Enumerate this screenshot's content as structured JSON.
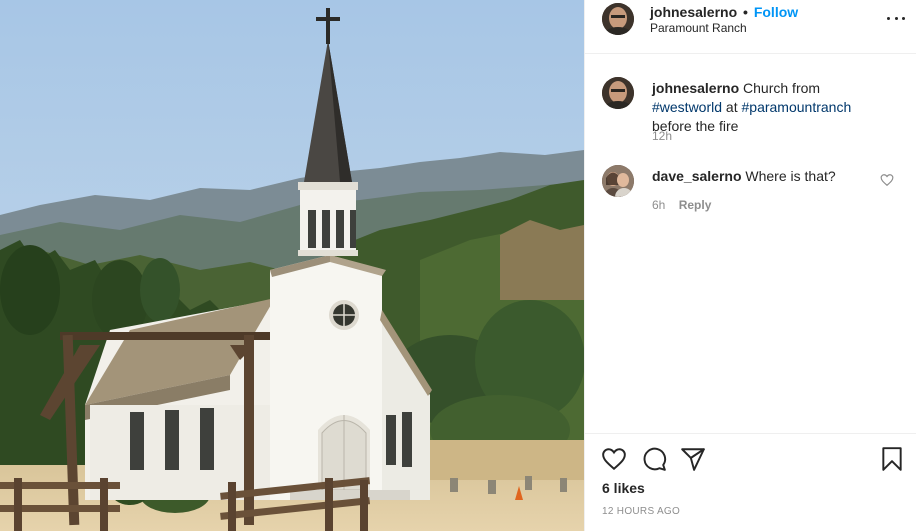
{
  "photo": {
    "subject": "white-church-photo"
  },
  "header": {
    "username": "johnesalerno",
    "separator": "•",
    "follow_label": "Follow",
    "location": "Paramount Ranch"
  },
  "caption": {
    "username": "johnesalerno",
    "text_before": "Church from",
    "hashtag1": "#westworld",
    "text_middle": "at",
    "hashtag2": "#paramountranch",
    "text_after": "before the fire",
    "age": "12h"
  },
  "comments": [
    {
      "username": "dave_salerno",
      "text": "Where is that?",
      "age": "6h",
      "reply_label": "Reply"
    }
  ],
  "footer": {
    "likes": "6 likes",
    "timestamp": "12 HOURS AGO"
  },
  "icons": {
    "more": "more-options-icon",
    "like": "heart-icon",
    "comment": "comment-icon",
    "share": "paper-plane-icon",
    "save": "bookmark-icon"
  },
  "colors": {
    "follow": "#0095f6",
    "hashtag": "#00376b",
    "secondary_text": "#8e8e8e",
    "border": "#efefef"
  }
}
